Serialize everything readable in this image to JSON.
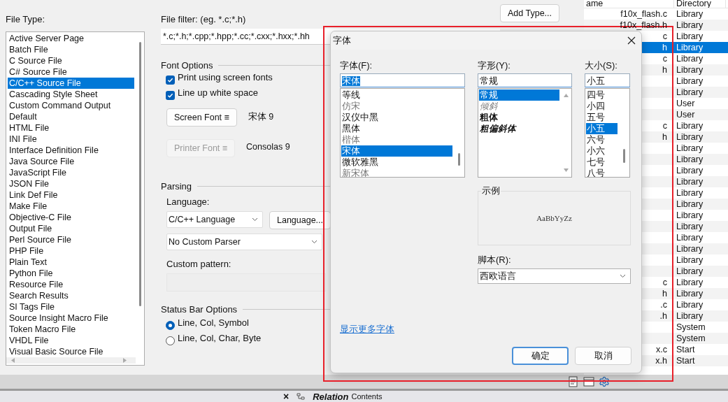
{
  "file_type_panel": {
    "label": "File Type:",
    "items": [
      {
        "label": "Active Server Page",
        "selected": false
      },
      {
        "label": "Batch File",
        "selected": false
      },
      {
        "label": "C Source File",
        "selected": false
      },
      {
        "label": "C# Source File",
        "selected": false
      },
      {
        "label": "C/C++ Source File",
        "selected": true
      },
      {
        "label": "Cascading Style Sheet",
        "selected": false
      },
      {
        "label": "Custom Command Output",
        "selected": false
      },
      {
        "label": "Default",
        "selected": false
      },
      {
        "label": "HTML File",
        "selected": false
      },
      {
        "label": "INI File",
        "selected": false
      },
      {
        "label": "Interface Definition File",
        "selected": false
      },
      {
        "label": "Java Source File",
        "selected": false
      },
      {
        "label": "JavaScript File",
        "selected": false
      },
      {
        "label": "JSON File",
        "selected": false
      },
      {
        "label": "Link Def File",
        "selected": false
      },
      {
        "label": "Make File",
        "selected": false
      },
      {
        "label": "Objective-C File",
        "selected": false
      },
      {
        "label": "Output File",
        "selected": false
      },
      {
        "label": "Perl Source File",
        "selected": false
      },
      {
        "label": "PHP File",
        "selected": false
      },
      {
        "label": "Plain Text",
        "selected": false
      },
      {
        "label": "Python File",
        "selected": false
      },
      {
        "label": "Resource File",
        "selected": false
      },
      {
        "label": "Search Results",
        "selected": false
      },
      {
        "label": "SI Tags File",
        "selected": false
      },
      {
        "label": "Source Insight Macro File",
        "selected": false
      },
      {
        "label": "Token Macro File",
        "selected": false
      },
      {
        "label": "VHDL File",
        "selected": false
      },
      {
        "label": "Visual Basic Source File",
        "selected": false
      }
    ]
  },
  "file_filter": {
    "label": "File filter: (eg. *.c;*.h)",
    "value": "*.c;*.h;*.cpp;*.hpp;*.cc;*.cxx;*.hxx;*.hh"
  },
  "add_type_button": "Add Type...",
  "font_options": {
    "title": "Font Options",
    "checkboxes": [
      {
        "label": "Print using screen fonts",
        "checked": true
      },
      {
        "label": "Line up white space",
        "checked": true
      }
    ],
    "fonts": [
      {
        "button": "Screen Font ≡",
        "disabled": false,
        "value": "宋体 9"
      },
      {
        "button": "Printer Font ≡",
        "disabled": true,
        "value": "Consolas 9"
      }
    ]
  },
  "parsing": {
    "title": "Parsing",
    "language_label": "Language:",
    "language": "C/C++ Language",
    "language_button": "Language...",
    "parser": "No Custom Parser",
    "pattern_label": "Custom pattern:"
  },
  "status_bar_options": {
    "title": "Status Bar Options",
    "options": [
      {
        "label": "Line, Col, Symbol",
        "selected": true
      },
      {
        "label": "Line, Col, Char, Byte",
        "selected": false
      }
    ]
  },
  "file_list": {
    "columns": [
      "ame",
      "Directory"
    ],
    "rows": [
      {
        "name": "f10x_flash.c",
        "directory": "Library",
        "selected": false
      },
      {
        "name": "f10x_flash.h",
        "directory": "Library",
        "selected": false
      },
      {
        "name": "c",
        "directory": "Library",
        "selected": false
      },
      {
        "name": "h",
        "directory": "Library",
        "selected": true
      },
      {
        "name": "c",
        "directory": "Library",
        "selected": false
      },
      {
        "name": "h",
        "directory": "Library",
        "selected": false
      },
      {
        "directory": "Library",
        "selected": false
      },
      {
        "directory": "Library",
        "selected": false
      },
      {
        "directory": "User",
        "selected": false
      },
      {
        "directory": "User",
        "selected": false
      },
      {
        "name": "c",
        "directory": "Library",
        "selected": false
      },
      {
        "name": "h",
        "directory": "Library",
        "selected": false
      },
      {
        "directory": "Library",
        "selected": false
      },
      {
        "directory": "Library",
        "selected": false
      },
      {
        "directory": "Library",
        "selected": false
      },
      {
        "directory": "Library",
        "selected": false
      },
      {
        "directory": "Library",
        "selected": false
      },
      {
        "directory": "Library",
        "selected": false
      },
      {
        "directory": "Library",
        "selected": false
      },
      {
        "directory": "Library",
        "selected": false
      },
      {
        "directory": "Library",
        "selected": false
      },
      {
        "directory": "Library",
        "selected": false
      },
      {
        "directory": "Library",
        "selected": false
      },
      {
        "directory": "Library",
        "selected": false
      },
      {
        "name": "c",
        "directory": "Library",
        "selected": false
      },
      {
        "name": "h",
        "directory": "Library",
        "selected": false
      },
      {
        "name": ".c",
        "directory": "Library",
        "selected": false
      },
      {
        "name": ".h",
        "directory": "Library",
        "selected": false
      },
      {
        "directory": "System",
        "selected": false
      },
      {
        "directory": "System",
        "selected": false
      },
      {
        "name": "x.c",
        "directory": "Start",
        "selected": false
      },
      {
        "name": "x.h",
        "directory": "Start",
        "selected": false
      }
    ]
  },
  "font_dialog": {
    "title": "字体",
    "font_label": "字体(F):",
    "font_value": "宋体",
    "value_selected": true,
    "fonts": [
      {
        "label": "等线",
        "kind": "sans",
        "selected": false
      },
      {
        "label": "仿宋",
        "kind": "serif",
        "selected": false
      },
      {
        "label": "汉仪中黑",
        "kind": "sans",
        "selected": false
      },
      {
        "label": "黑体",
        "kind": "sans",
        "selected": false
      },
      {
        "label": "楷体",
        "kind": "serif",
        "selected": false
      },
      {
        "label": "宋体",
        "kind": "serif",
        "selected": true
      },
      {
        "label": "微软雅黑",
        "kind": "sans",
        "selected": false
      },
      {
        "label": "新宋体",
        "kind": "serif",
        "selected": false
      }
    ],
    "style_label": "字形(Y):",
    "style_value": "常规",
    "styles": [
      {
        "label": "常规",
        "kind": "regular",
        "selected": true
      },
      {
        "label": "倾斜",
        "kind": "italic",
        "selected": false
      },
      {
        "label": "粗体",
        "kind": "bold",
        "selected": false
      },
      {
        "label": "粗偏斜体",
        "kind": "bold-italic",
        "selected": false
      }
    ],
    "size_label": "大小(S):",
    "size_value": "小五",
    "sizes": [
      {
        "label": "四号",
        "selected": false
      },
      {
        "label": "小四",
        "selected": false
      },
      {
        "label": "五号",
        "selected": false
      },
      {
        "label": "小五",
        "selected": true
      },
      {
        "label": "六号",
        "selected": false
      },
      {
        "label": "小六",
        "selected": false
      },
      {
        "label": "七号",
        "selected": false
      },
      {
        "label": "八号",
        "selected": false
      }
    ],
    "sample_label": "示例",
    "sample_text": "AaBbYyZz",
    "script_label": "脚本(R):",
    "script_value": "西欧语言",
    "more_link": "显示更多字体",
    "buttons": [
      {
        "label": "确定",
        "kind": "primary"
      },
      {
        "label": "取消",
        "kind": "secondary"
      }
    ]
  },
  "bottom_tabs": {
    "close": "×",
    "title": "Relation",
    "subtitle": "Contents"
  }
}
